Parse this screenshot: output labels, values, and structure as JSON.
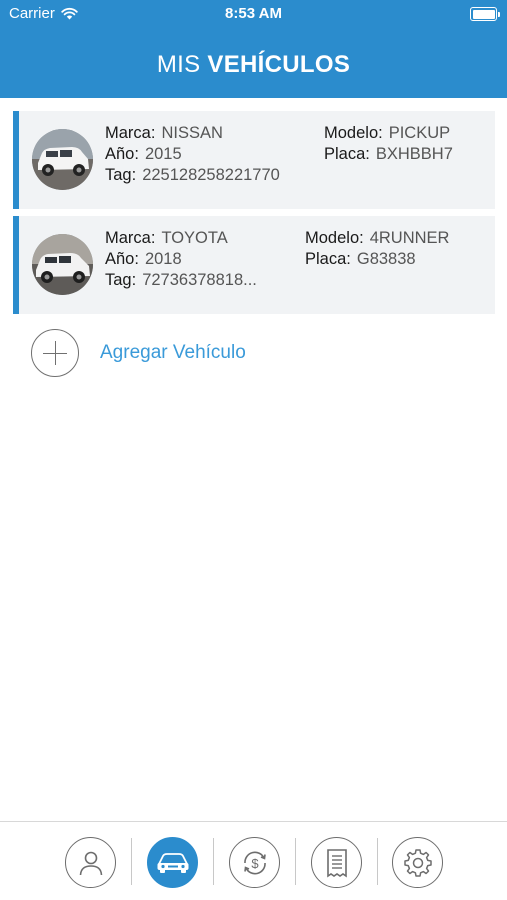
{
  "status_bar": {
    "carrier": "Carrier",
    "time": "8:53 AM",
    "wifi_icon": "wifi-icon",
    "battery_icon": "battery-icon"
  },
  "header": {
    "title_regular": "MIS",
    "title_bold": "VEHÍCULOS",
    "color": "#2b8ccd"
  },
  "vehicles": [
    {
      "marca_label": "Marca:",
      "marca": "NISSAN",
      "anio_label": "Año:",
      "anio": "2015",
      "tag_label": "Tag:",
      "tag": "225128258221770",
      "modelo_label": "Modelo:",
      "modelo": "PICKUP",
      "placa_label": "Placa:",
      "placa": "BXHBBH7",
      "photo": "white-suv-photo"
    },
    {
      "marca_label": "Marca:",
      "marca": "TOYOTA",
      "anio_label": "Año:",
      "anio": "2018",
      "tag_label": "Tag:",
      "tag": "72736378818...",
      "modelo_label": "Modelo:",
      "modelo": "4RUNNER",
      "placa_label": "Placa:",
      "placa": "G83838",
      "photo": "white-suv-photo"
    }
  ],
  "add_vehicle": {
    "label": "Agregar Vehículo",
    "icon": "plus-circle-icon"
  },
  "tabbar": {
    "tabs": [
      {
        "icon": "user-icon",
        "active": false
      },
      {
        "icon": "car-icon",
        "active": true
      },
      {
        "icon": "dollar-refresh-icon",
        "active": false
      },
      {
        "icon": "receipt-icon",
        "active": false
      },
      {
        "icon": "gear-icon",
        "active": false
      }
    ],
    "active_color": "#2b8ccd"
  }
}
